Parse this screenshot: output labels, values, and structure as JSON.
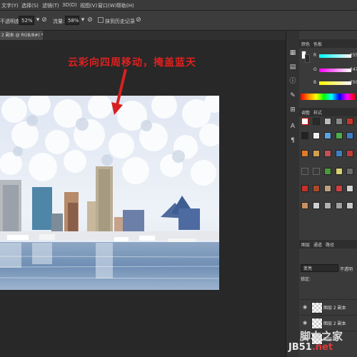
{
  "menubar": {
    "items": [
      "文字(Y)",
      "选择(S)",
      "滤镜(T)",
      "3D(D)",
      "视图(V)",
      "窗口(W)",
      "帮助(H)"
    ]
  },
  "options": {
    "opacity_label": "不透明度:",
    "opacity_value": "52%",
    "flow_label": "流量:",
    "flow_value": "58%",
    "history_label": "抹到历史记录"
  },
  "document": {
    "tab_label": "2 副本 @ RGB/8#) *"
  },
  "annotation": {
    "text": "云彩向四周移动，掩盖蓝天",
    "color": "#e02020"
  },
  "color_panel": {
    "tabs": [
      "颜色",
      "色板"
    ],
    "channels": [
      {
        "label": "R",
        "value": "255"
      },
      {
        "label": "G",
        "value": "247"
      },
      {
        "label": "B",
        "value": "250"
      }
    ]
  },
  "styles_panel": {
    "tabs": [
      "调整",
      "样式"
    ]
  },
  "layers_panel": {
    "tabs": [
      "图层",
      "通道",
      "路径"
    ],
    "blend_mode": "变亮",
    "opacity_label": "不透明",
    "lock_label": "锁定:",
    "layers": [
      {
        "name": "图层 2 副本"
      },
      {
        "name": "图层 2 副本"
      },
      {
        "name": "图层 2"
      }
    ]
  },
  "watermark": {
    "line1": "脚本之家",
    "line2_a": "JB51",
    "line2_b": ".net"
  }
}
